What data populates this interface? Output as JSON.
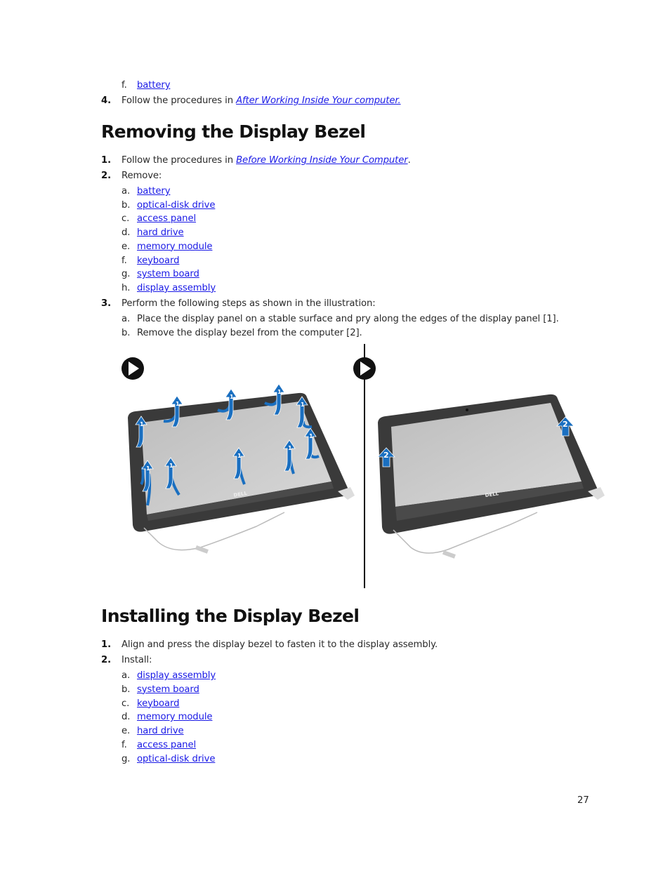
{
  "prev_section": {
    "sub_item": {
      "marker": "f.",
      "link": "battery"
    },
    "step": {
      "marker": "4.",
      "text": "Follow the procedures in ",
      "link": "After Working Inside Your computer."
    }
  },
  "removing": {
    "title": "Removing the Display Bezel",
    "steps": [
      {
        "marker": "1.",
        "text": "Follow the procedures in ",
        "link": "Before Working Inside Your Computer",
        "suffix": "."
      },
      {
        "marker": "2.",
        "text": "Remove:",
        "items": [
          {
            "marker": "a.",
            "link": "battery"
          },
          {
            "marker": "b.",
            "link": "optical-disk drive"
          },
          {
            "marker": "c.",
            "link": "access panel"
          },
          {
            "marker": "d.",
            "link": "hard drive"
          },
          {
            "marker": "e.",
            "link": "memory module"
          },
          {
            "marker": "f.",
            "link": "keyboard"
          },
          {
            "marker": "g.",
            "link": "system board"
          },
          {
            "marker": "h.",
            "link": "display assembly"
          }
        ]
      },
      {
        "marker": "3.",
        "text": "Perform the following steps as shown in the illustration:",
        "substeps": [
          {
            "marker": "a.",
            "text": "Place the display panel on a stable surface and pry along the edges of the display panel [1]."
          },
          {
            "marker": "b.",
            "text": "Remove the display bezel from the computer [2]."
          }
        ]
      }
    ],
    "figure": {
      "panel1_callout": "1",
      "panel2_callout": "2",
      "logo_text": "DELL",
      "arrow_color": "#1a6fc0",
      "bezel_color": "#3a3a3a",
      "screen_color": "#c8c8c8"
    }
  },
  "installing": {
    "title": "Installing the Display Bezel",
    "steps": [
      {
        "marker": "1.",
        "text": "Align and press the display bezel to fasten it to the display assembly."
      },
      {
        "marker": "2.",
        "text": "Install:",
        "items": [
          {
            "marker": "a.",
            "link": "display assembly"
          },
          {
            "marker": "b.",
            "link": "system board"
          },
          {
            "marker": "c.",
            "link": "keyboard"
          },
          {
            "marker": "d.",
            "link": "memory module"
          },
          {
            "marker": "e.",
            "link": "hard drive"
          },
          {
            "marker": "f.",
            "link": "access panel"
          },
          {
            "marker": "g.",
            "link": "optical-disk drive"
          }
        ]
      }
    ]
  },
  "footer": {
    "page_number": "27"
  }
}
